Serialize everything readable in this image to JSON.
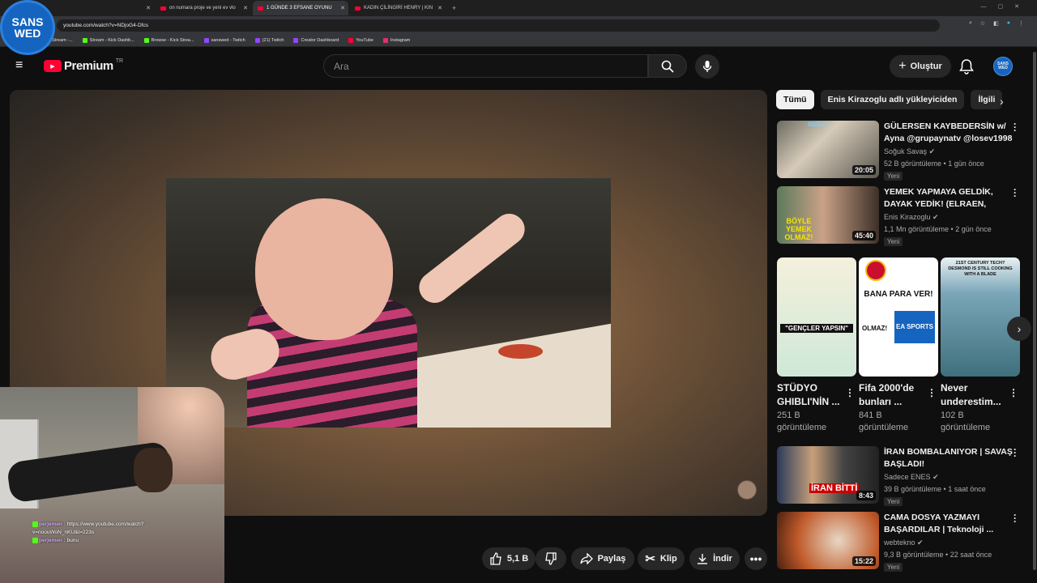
{
  "browser": {
    "tabs": [
      {
        "label": "on numara proje ve yeni ev vlo",
        "active": false
      },
      {
        "label": "1 GÜNDE 3 EFSANE OYUNU",
        "active": true
      },
      {
        "label": "KADIN ÇİLİNGİRİ HENRY | KIN",
        "active": false
      }
    ],
    "url": "youtube.com/watch?v=NDjoG4-Dfcs",
    "bookmarks": [
      "Stream -...",
      "Stream - Kick Dashb...",
      "Browse - Kick Strea...",
      "sanswed - Twitch",
      "(21) Twitch",
      "Creator Dashboard",
      "YouTube",
      "Instagram"
    ]
  },
  "overlay_logo": {
    "line1": "SANS",
    "line2": "WED"
  },
  "youtube": {
    "brand": "Premium",
    "country": "TR",
    "search_placeholder": "Ara",
    "create_label": "Oluştur",
    "avatar_text": "SANS WED"
  },
  "stream_chat": [
    {
      "user": "perjemen :",
      "text": "https://www.youtube.com/watch?"
    },
    {
      "user": "",
      "text": "v=noouWoN_nKU&t=223s"
    },
    {
      "user": "perjemen :",
      "text": "bunu"
    }
  ],
  "actions": {
    "like_count": "5,1 B",
    "share": "Paylaş",
    "clip": "Klip",
    "download": "İndir"
  },
  "chips": [
    "Tümü",
    "Enis Kirazoglu adlı yükleyiciden",
    "İlgili"
  ],
  "videos": [
    {
      "title": "GÜLERSEN KAYBEDERSİN w/ Ayna @grupaynatv @losev1998",
      "channel": "Soğuk Savaş",
      "views": "52 B görüntüleme",
      "age": "1 gün önce",
      "badge": "Yeni",
      "duration": "20:05",
      "thumb_text": "SOĞUK"
    },
    {
      "title": "YEMEK YAPMAYA GELDİK, DAYAK YEDİK! (ELRAEN, ERAY,...",
      "channel": "Enis Kirazoglu",
      "views": "1,1 Mn görüntüleme",
      "age": "2 gün önce",
      "badge": "Yeni",
      "duration": "45:40",
      "thumb_text": "BÖYLE YEMEK OLMAZ!"
    },
    {
      "title": "İRAN BOMBALANIYOR | SAVAŞ BAŞLADI!",
      "channel": "Sadece ENES",
      "views": "39 B görüntüleme",
      "age": "1 saat önce",
      "badge": "Yeni",
      "duration": "8:43",
      "thumb_text": "İRAN BİTTİ"
    },
    {
      "title": "CAMA DOSYA YAZMAYI BAŞARDILAR | Teknoloji ...",
      "channel": "webtekno",
      "views": "9,3 B görüntüleme",
      "age": "22 saat önce",
      "badge": "Yeni",
      "duration": "15:22",
      "thumb_text": ""
    }
  ],
  "shorts": [
    {
      "title": "STÜDYO GHIBLI'NİN ...",
      "views": "251 B görüntüleme",
      "thumb_text": "\"GENÇLER YAPSIN\""
    },
    {
      "title": "Fifa 2000'de bunları ...",
      "views": "841 B görüntüleme",
      "thumb_text": "BANA PARA VER!",
      "thumb_text2": "OLMAZ!",
      "logo_text": "EA SPORTS"
    },
    {
      "title": "Never underestim...",
      "views": "102 B görüntüleme",
      "thumb_text": "21ST CENTURY TECH? DESMOND IS STILL COOKING WITH A BLADE"
    }
  ],
  "colors": {
    "accent": "#ff0033",
    "background": "#0f0f0f",
    "chip_bg": "#272727",
    "twitch": "#9146ff",
    "kick": "#53fc18"
  }
}
